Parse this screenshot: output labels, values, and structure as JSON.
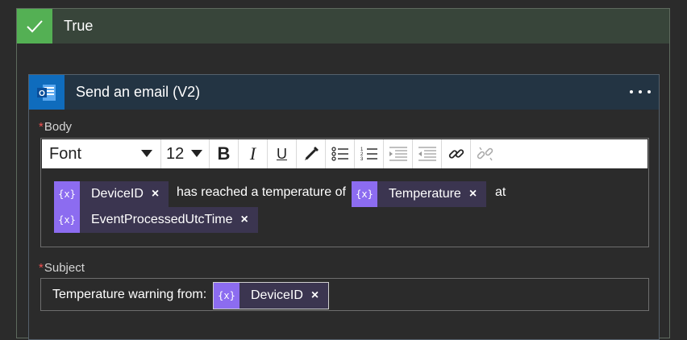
{
  "condition": {
    "title": "True",
    "icon": "checkmark-icon",
    "accent": "#54b054"
  },
  "action": {
    "title": "Send an email (V2)",
    "icon": "outlook-icon",
    "more_icon": "more-options-icon"
  },
  "body": {
    "label": "Body",
    "required_marker": "*",
    "toolbar": {
      "font": "Font",
      "size": "12",
      "icons": [
        "bold-icon",
        "italic-icon",
        "underline-icon",
        "highlight-icon",
        "bullet-list-icon",
        "numbered-list-icon",
        "decrease-indent-icon",
        "increase-indent-icon",
        "link-icon",
        "unlink-icon"
      ],
      "bold": "B",
      "italic": "I",
      "underline": "U"
    },
    "content": {
      "token1": "DeviceID",
      "text1": "has reached a temperature of",
      "token2": "Temperature",
      "text2": "at",
      "token3": "EventProcessedUtcTime"
    }
  },
  "subject": {
    "label": "Subject",
    "required_marker": "*",
    "text": "Temperature warning from:",
    "token": "DeviceID"
  },
  "token_symbol": "{x}",
  "close_symbol": "×",
  "colors": {
    "token_icon": "#8c6cf0",
    "token_bg": "#3b3550",
    "card_header": "#233443",
    "scope_header": "#38453a"
  }
}
